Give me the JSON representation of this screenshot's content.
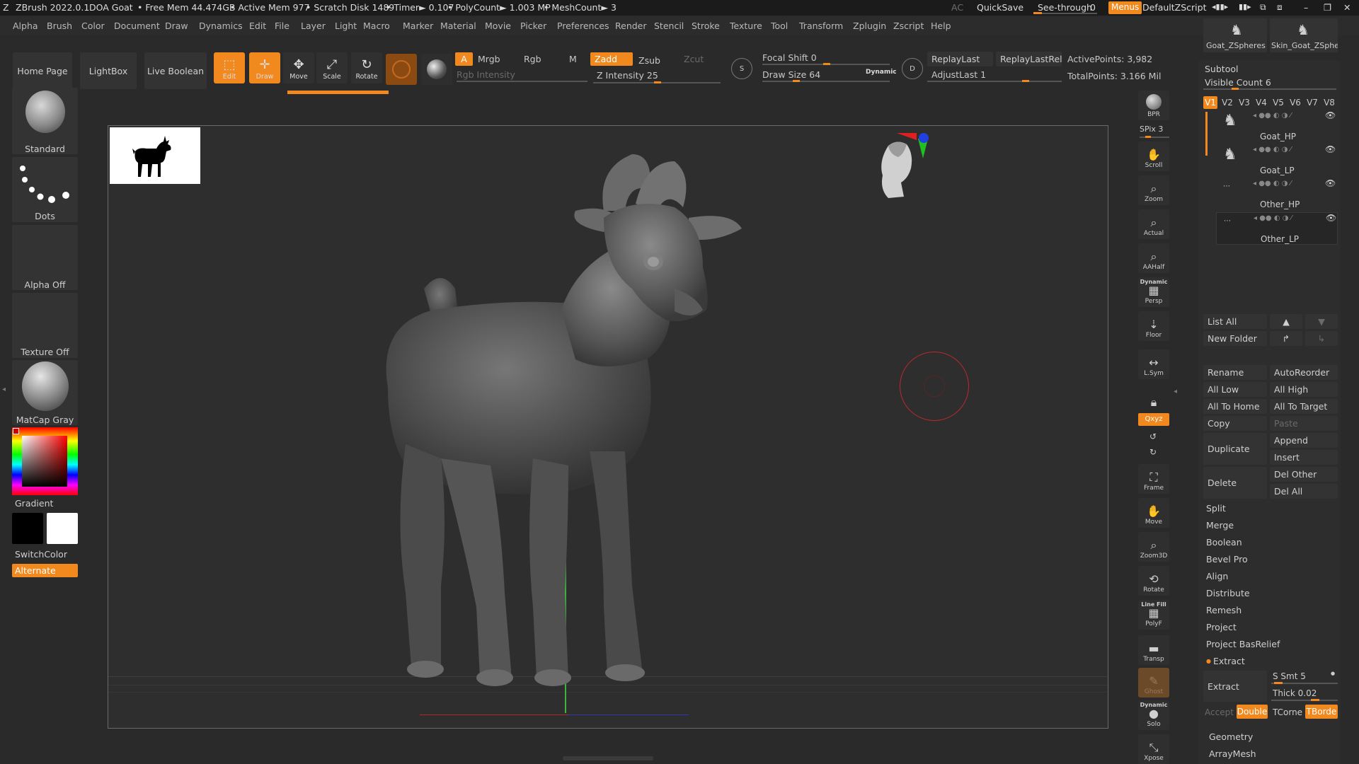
{
  "titlebar": {
    "app": "ZBrush 2022.0.1",
    "document": "DOA Goat",
    "free_mem": "• Free Mem 44.474GB",
    "active_mem": "• Active Mem 977",
    "scratch": "• Scratch Disk 1489",
    "timer": "• Timer► 0.107",
    "polycount": "• PolyCount► 1.003 MP",
    "meshcount": "• MeshCount► 3",
    "ac": "AC",
    "quicksave": "QuickSave",
    "see_through": "See-through",
    "see_through_value": "0",
    "menus": "Menus",
    "default_script": "DefaultZScript"
  },
  "menubar": [
    "Alpha",
    "Brush",
    "Color",
    "Document",
    "Draw",
    "Dynamics",
    "Edit",
    "File",
    "Layer",
    "Light",
    "Macro",
    "Marker",
    "Material",
    "Movie",
    "Picker",
    "Preferences",
    "Render",
    "Stencil",
    "Stroke",
    "Texture",
    "Tool",
    "Transform",
    "Zplugin",
    "Zscript",
    "Help"
  ],
  "shelf": {
    "home_page": "Home Page",
    "lightbox": "LightBox",
    "live_boolean": "Live Boolean",
    "edit": "Edit",
    "draw": "Draw",
    "move": "Move",
    "scale": "Scale",
    "rotate": "Rotate",
    "a": "A",
    "mrgb": "Mrgb",
    "rgb": "Rgb",
    "m": "M",
    "rgb_intensity": "Rgb Intensity",
    "zadd": "Zadd",
    "zsub": "Zsub",
    "zcut": "Zcut",
    "z_intensity": "Z Intensity 25",
    "focal_shift": "Focal Shift 0",
    "draw_size": "Draw Size 64",
    "dynamic": "Dynamic",
    "replay_last": "ReplayLast",
    "replay_last_rel": "ReplayLastRel",
    "adjust_last": "AdjustLast 1",
    "active_points": "ActivePoints: 3,982",
    "total_points": "TotalPoints: 3.166 Mil",
    "s_label": "S",
    "d_label": "D"
  },
  "left_tray": {
    "brush": "Standard",
    "stroke": "Dots",
    "alpha": "Alpha Off",
    "texture": "Texture Off",
    "material": "MatCap Gray",
    "gradient": "Gradient",
    "switch_color": "SwitchColor",
    "alternate": "Alternate"
  },
  "right_toolbar": {
    "bpr": "BPR",
    "spix": "SPix 3",
    "scroll": "Scroll",
    "zoom": "Zoom",
    "actual": "Actual",
    "aahalf": "AAHalf",
    "dynamic": "Dynamic",
    "persp": "Persp",
    "floor": "Floor",
    "lsym": "L.Sym",
    "xyz": "Qxyz",
    "frame": "Frame",
    "move": "Move",
    "zoom3d": "Zoom3D",
    "rotate": "Rotate",
    "line_fill": "Line Fill",
    "polyf": "PolyF",
    "transp": "Transp",
    "ghost": "Ghost",
    "dynamic2": "Dynamic",
    "solo": "Solo",
    "xpose": "Xpose"
  },
  "tool_thumbs": [
    "Goat_ZSpheres",
    "Skin_Goat_ZSphe"
  ],
  "subtool": {
    "title": "Subtool",
    "visible_count": "Visible Count 6",
    "vtabs": [
      "V1",
      "V2",
      "V3",
      "V4",
      "V5",
      "V6",
      "V7",
      "V8"
    ],
    "items": [
      "Goat_HP",
      "Goat_LP",
      "Other_HP",
      "Other_LP"
    ],
    "list_all": "List All",
    "new_folder": "New Folder",
    "rename": "Rename",
    "auto_reorder": "AutoReorder",
    "all_low": "All Low",
    "all_high": "All High",
    "all_to_home": "All To Home",
    "all_to_target": "All To Target",
    "copy": "Copy",
    "paste": "Paste",
    "duplicate": "Duplicate",
    "append": "Append",
    "insert": "Insert",
    "delete": "Delete",
    "del_other": "Del Other",
    "del_all": "Del All",
    "sections": [
      "Split",
      "Merge",
      "Boolean",
      "Bevel Pro",
      "Align",
      "Distribute",
      "Remesh",
      "Project",
      "Project BasRelief"
    ],
    "extract": "Extract",
    "extract_btn": "Extract",
    "s_smt": "S Smt 5",
    "thick": "Thick 0.02",
    "accept": "Accept",
    "double": "Double",
    "tcorne": "TCorne",
    "tborde": "TBorde",
    "geometry": "Geometry",
    "arraymesh": "ArrayMesh"
  },
  "colors": {
    "accent": "#f2891f",
    "panel": "#333333",
    "background": "#2a2a2a"
  }
}
